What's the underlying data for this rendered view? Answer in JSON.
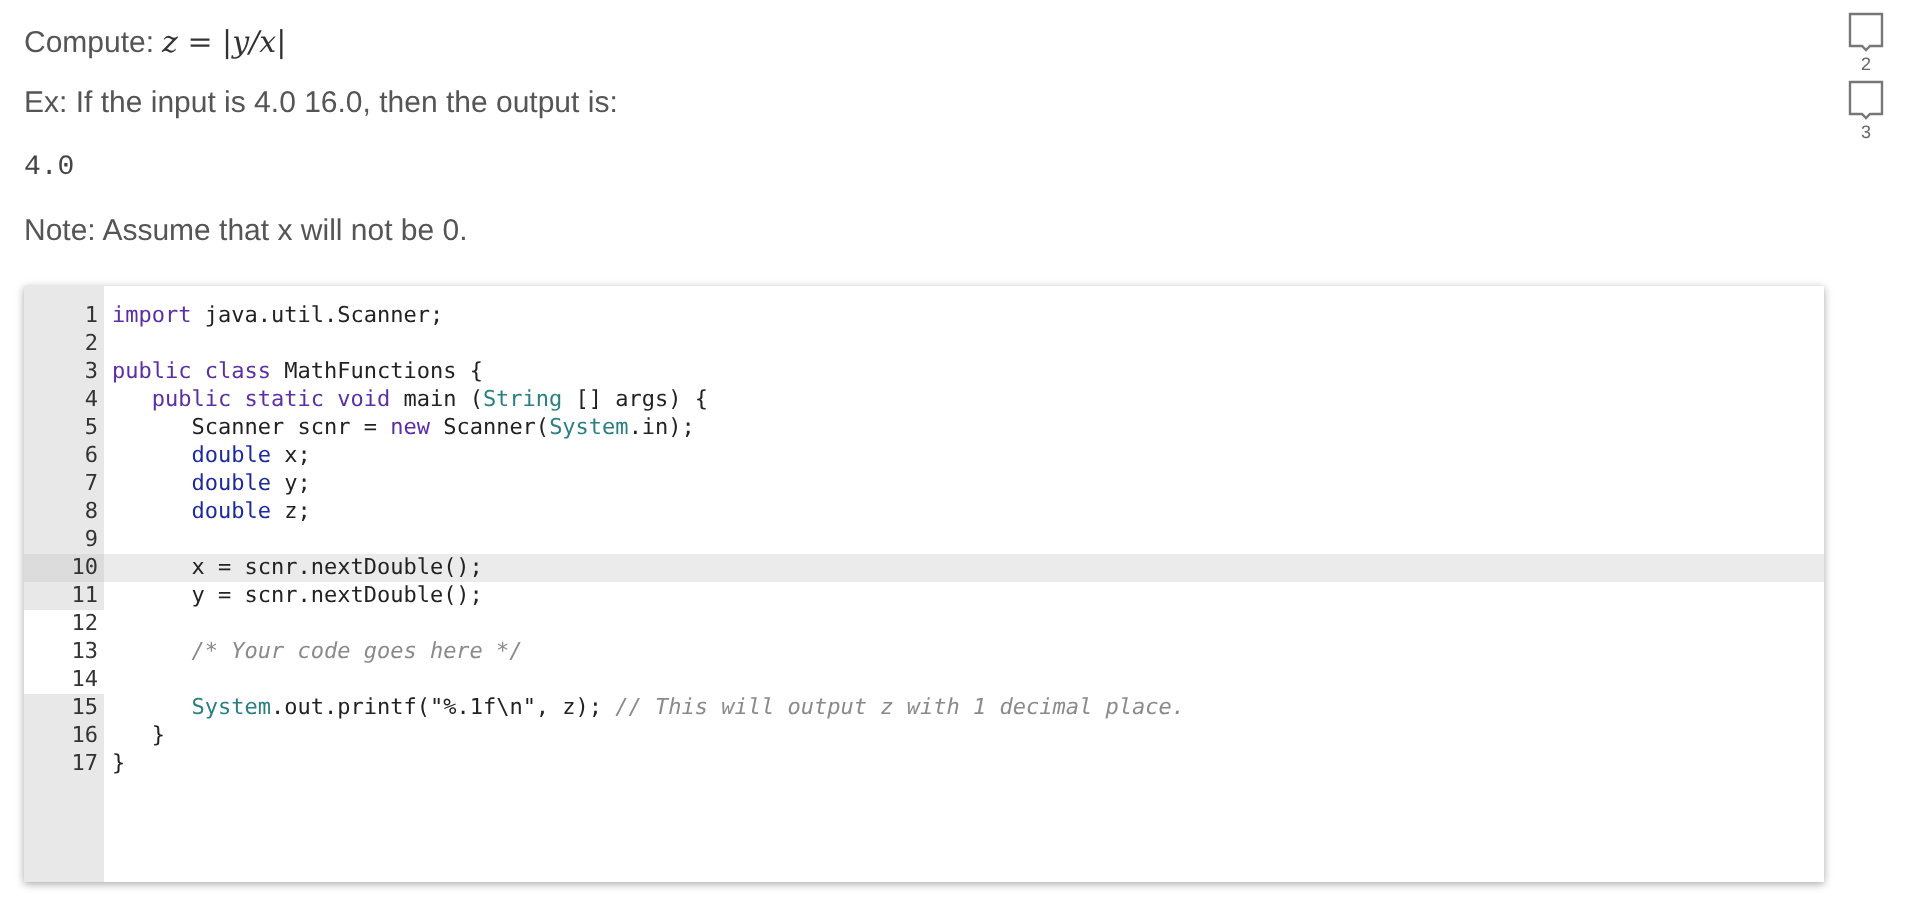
{
  "prompt": {
    "label": "Compute:",
    "formula": "z = |y/x|"
  },
  "example": "Ex: If the input is 4.0 16.0, then the output is:",
  "example_output": "4.0",
  "note": "Note: Assume that x will not be 0.",
  "editor": {
    "lines": [
      {
        "number": "1",
        "active": false,
        "editable": false,
        "tokens": [
          {
            "kind": "kw",
            "text": "import"
          },
          {
            "kind": "plain",
            "text": " java.util.Scanner;"
          }
        ]
      },
      {
        "number": "2",
        "active": false,
        "editable": false
      },
      {
        "number": "3",
        "active": false,
        "editable": false,
        "tokens": [
          {
            "kind": "kw",
            "text": "public class"
          },
          {
            "kind": "plain",
            "text": " MathFunctions {"
          }
        ]
      },
      {
        "number": "4",
        "active": false,
        "editable": false,
        "tokens": [
          {
            "kind": "kw",
            "text": "   public static void"
          },
          {
            "kind": "plain",
            "text": " main ("
          },
          {
            "kind": "builtin",
            "text": "String"
          },
          {
            "kind": "plain",
            "text": " [] args) {"
          }
        ]
      },
      {
        "number": "5",
        "active": false,
        "editable": false,
        "tokens": [
          {
            "kind": "plain",
            "text": "      Scanner scnr = "
          },
          {
            "kind": "kw",
            "text": "new"
          },
          {
            "kind": "plain",
            "text": " Scanner("
          },
          {
            "kind": "builtin",
            "text": "System"
          },
          {
            "kind": "plain",
            "text": ".in);"
          }
        ]
      },
      {
        "number": "6",
        "active": false,
        "editable": false,
        "tokens": [
          {
            "kind": "type",
            "text": "      double"
          },
          {
            "kind": "plain",
            "text": " x;"
          }
        ]
      },
      {
        "number": "7",
        "active": false,
        "editable": false,
        "tokens": [
          {
            "kind": "type",
            "text": "      double"
          },
          {
            "kind": "plain",
            "text": " y;"
          }
        ]
      },
      {
        "number": "8",
        "active": false,
        "editable": false,
        "tokens": [
          {
            "kind": "type",
            "text": "      double"
          },
          {
            "kind": "plain",
            "text": " z;"
          }
        ]
      },
      {
        "number": "9",
        "active": false,
        "editable": false
      },
      {
        "number": "10",
        "active": true,
        "editable": false,
        "tokens": [
          {
            "kind": "plain",
            "text": "      x = scnr.nextDouble();"
          }
        ]
      },
      {
        "number": "11",
        "active": false,
        "editable": false,
        "tokens": [
          {
            "kind": "plain",
            "text": "      y = scnr.nextDouble();"
          }
        ]
      },
      {
        "number": "12",
        "active": false,
        "editable": true
      },
      {
        "number": "13",
        "active": false,
        "editable": true,
        "tokens": [
          {
            "kind": "comment",
            "text": "      /* Your code goes here */"
          }
        ]
      },
      {
        "number": "14",
        "active": false,
        "editable": true
      },
      {
        "number": "15",
        "active": false,
        "editable": false,
        "tokens": [
          {
            "kind": "builtin",
            "text": "      System"
          },
          {
            "kind": "plain",
            "text": ".out.printf(\"%.1f\\n\", z); "
          },
          {
            "kind": "comment",
            "text": "// This will output z with 1 decimal place."
          }
        ]
      },
      {
        "number": "16",
        "active": false,
        "editable": false,
        "tokens": [
          {
            "kind": "plain",
            "text": "   }"
          }
        ]
      },
      {
        "number": "17",
        "active": false,
        "editable": false,
        "tokens": [
          {
            "kind": "plain",
            "text": "}"
          }
        ]
      }
    ]
  },
  "checkpoints": [
    {
      "label": "2"
    },
    {
      "label": "3"
    }
  ]
}
